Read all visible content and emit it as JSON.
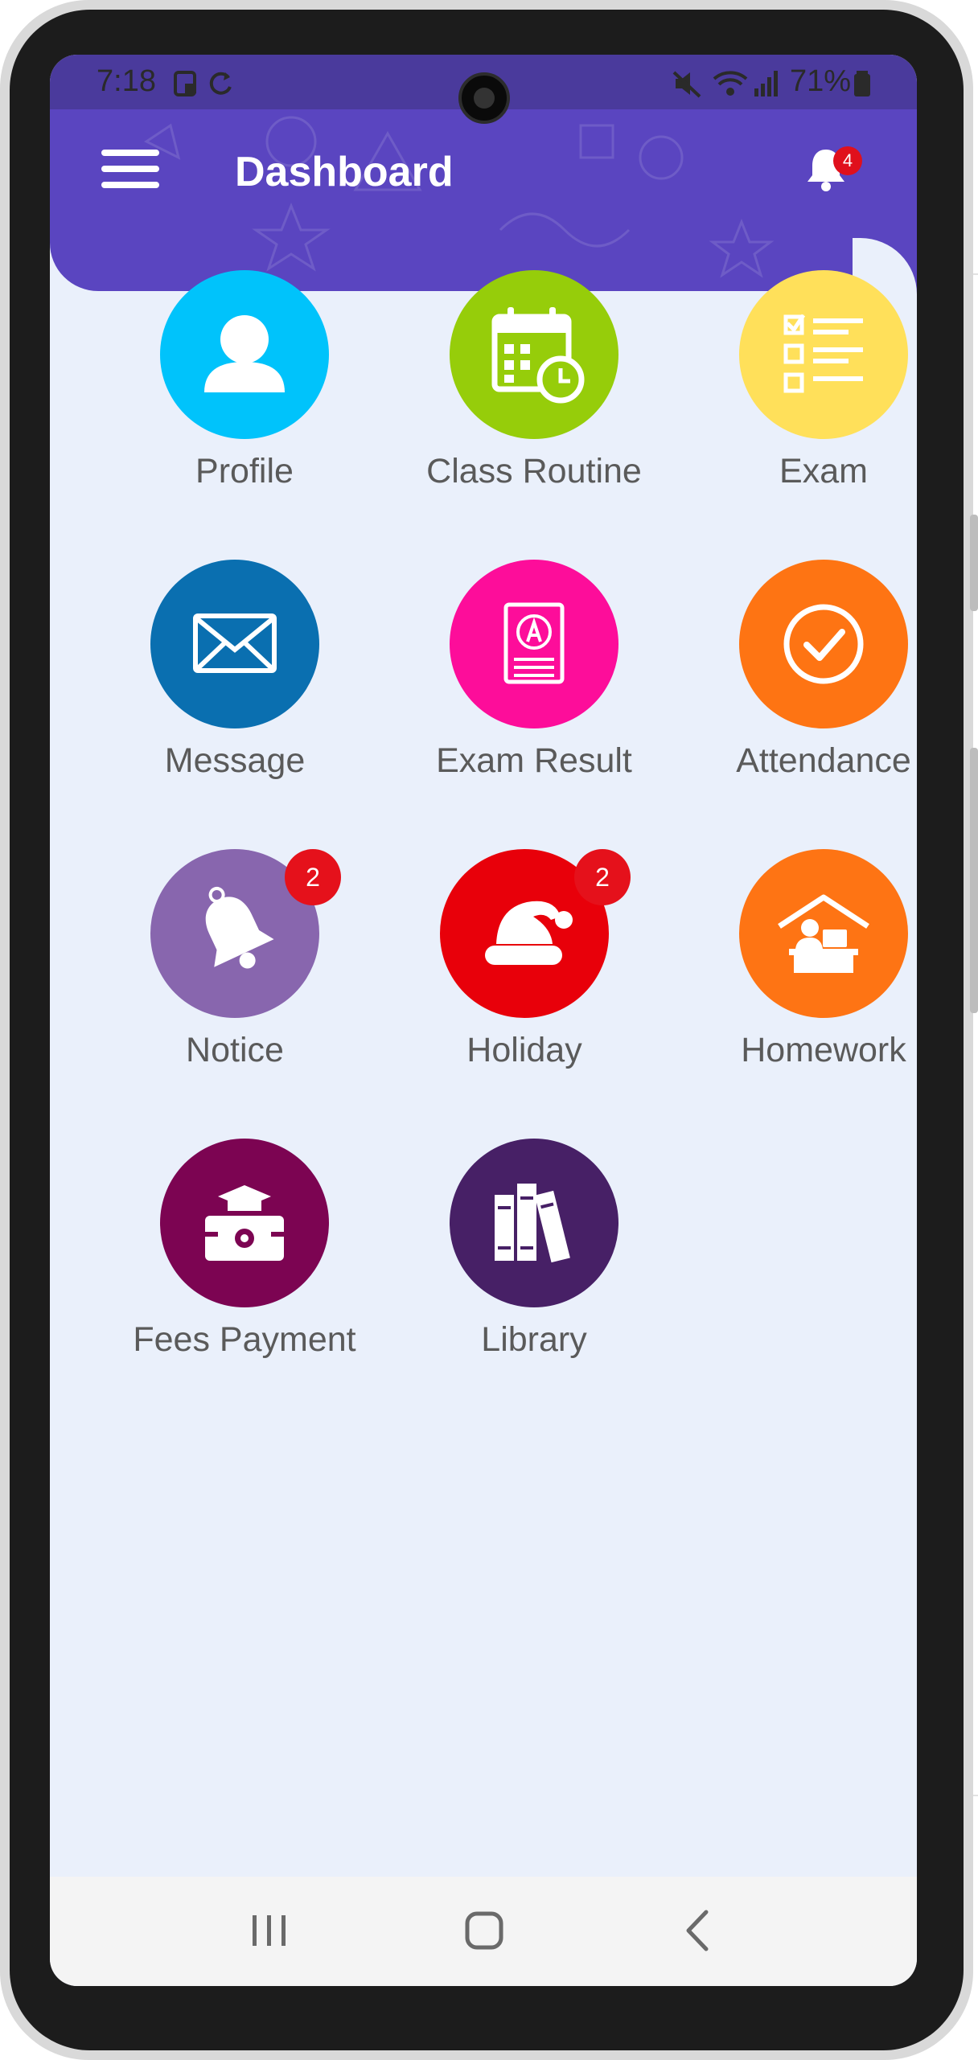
{
  "status_bar": {
    "time": "7:18",
    "battery": "71%"
  },
  "app_bar": {
    "title": "Dashboard",
    "notification_count": "4"
  },
  "tiles": [
    {
      "label": "Profile",
      "color": "#00c3fb",
      "icon": "person-icon"
    },
    {
      "label": "Class Routine",
      "color": "#96cd0a",
      "icon": "calendar-clock-icon"
    },
    {
      "label": "Exam",
      "color": "#ffe05a",
      "icon": "checklist-icon"
    },
    {
      "label": "Message",
      "color": "#0a6fb0",
      "icon": "envelope-icon"
    },
    {
      "label": "Exam Result",
      "color": "#fd0d9a",
      "icon": "grade-report-icon"
    },
    {
      "label": "Attendance",
      "color": "#fe7413",
      "icon": "checkmark-circle-icon"
    },
    {
      "label": "Notice",
      "color": "#8866ae",
      "icon": "bell-icon",
      "badge": "2"
    },
    {
      "label": "Holiday",
      "color": "#e8000a",
      "icon": "santa-hat-icon",
      "badge": "2"
    },
    {
      "label": "Homework",
      "color": "#fe7414",
      "icon": "home-desk-icon"
    },
    {
      "label": "Fees Payment",
      "color": "#7c0452",
      "icon": "graduation-wallet-icon"
    },
    {
      "label": "Library",
      "color": "#472066",
      "icon": "books-icon"
    }
  ],
  "colors": {
    "app_bar": "#5a45c0",
    "background": "#eaf0fb",
    "badge": "#e5111b"
  }
}
